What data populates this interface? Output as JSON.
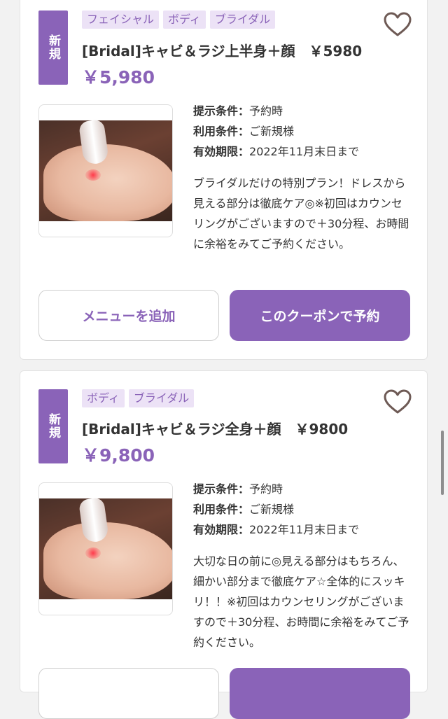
{
  "coupons": [
    {
      "badge": "新規",
      "tags": [
        "フェイシャル",
        "ボディ",
        "ブライダル"
      ],
      "title": "[Bridal]キャビ＆ラジ上半身＋顔　￥5980",
      "price": "￥5,980",
      "conditions": [
        {
          "key": "提示条件：",
          "value": "予約時"
        },
        {
          "key": "利用条件：",
          "value": "ご新規様"
        },
        {
          "key": "有効期限：",
          "value": "2022年11月末日まで"
        }
      ],
      "description": "ブライダルだけの特別プラン！ドレスから見える部分は徹底ケア◎※初回はカウンセリングがございますので＋30分程、お時間に余裕をみてご予約ください。",
      "add_menu_label": "メニューを追加",
      "reserve_label": "このクーポンで予約"
    },
    {
      "badge": "新規",
      "tags": [
        "ボディ",
        "ブライダル"
      ],
      "title": "[Bridal]キャビ＆ラジ全身＋顔　￥9800",
      "price": "￥9,800",
      "conditions": [
        {
          "key": "提示条件：",
          "value": "予約時"
        },
        {
          "key": "利用条件：",
          "value": "ご新規様"
        },
        {
          "key": "有効期限：",
          "value": "2022年11月末日まで"
        }
      ],
      "description": "大切な日の前に◎見える部分はもちろん、細かい部分まで徹底ケア☆全体的にスッキリ！！※初回はカウンセリングがございますので＋30分程、お時間に余裕をみてご予約ください。"
    }
  ],
  "icons": {
    "favorite": "heart-outline-icon"
  },
  "colors": {
    "accent": "#8a63b8",
    "tag_bg": "#ece2f6"
  }
}
